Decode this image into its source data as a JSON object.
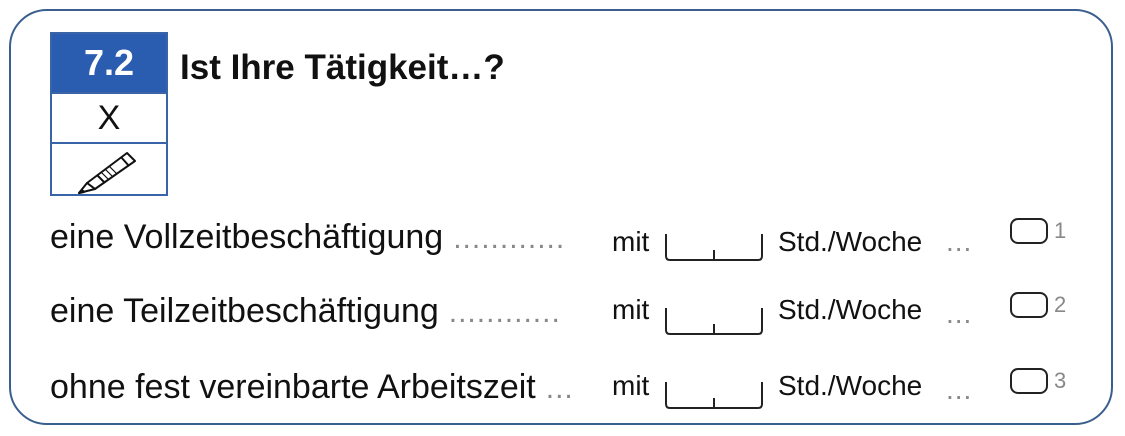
{
  "question": {
    "number": "7.2",
    "marker": "X",
    "title": "Ist Ihre Tätigkeit…?"
  },
  "icons": {
    "pencil": "pencil-icon"
  },
  "colors": {
    "frame": "#3a5f8f",
    "number_bg": "#2a5db0",
    "dots": "#888888"
  },
  "options": [
    {
      "label": "eine Vollzeitbeschäftigung",
      "dots": "............",
      "mit": "mit",
      "unit": "Std./Woche",
      "trail": "...",
      "code": "1"
    },
    {
      "label": "eine Teilzeitbeschäftigung",
      "dots": "............",
      "mit": "mit",
      "unit": "Std./Woche",
      "trail": "...",
      "code": "2"
    },
    {
      "label": "ohne fest vereinbarte Arbeitszeit",
      "dots": "...",
      "mit": "mit",
      "unit": "Std./Woche",
      "trail": "...",
      "code": "3"
    }
  ]
}
